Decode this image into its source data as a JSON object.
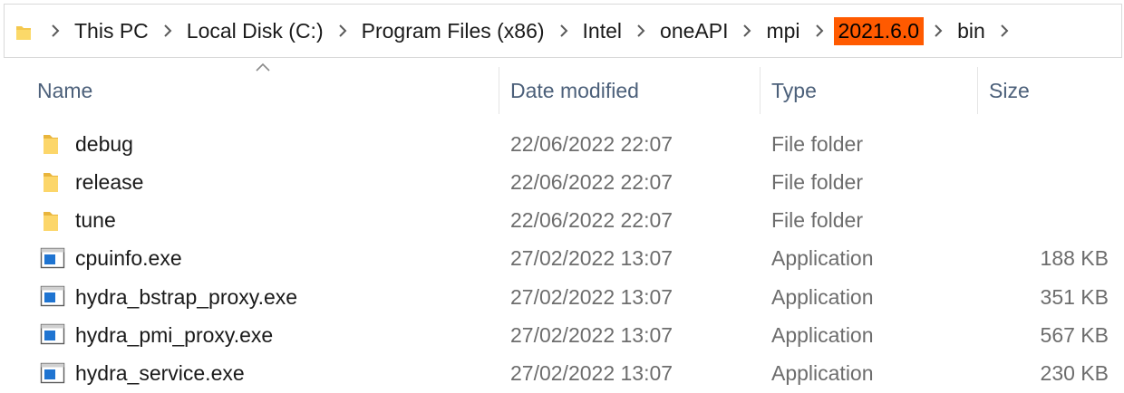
{
  "breadcrumb": [
    "This PC",
    "Local Disk (C:)",
    "Program Files (x86)",
    "Intel",
    "oneAPI",
    "mpi",
    "2021.6.0",
    "bin"
  ],
  "highlight_index": 6,
  "highlight_color": "#ff5a00",
  "columns": {
    "name": "Name",
    "date": "Date modified",
    "type": "Type",
    "size": "Size"
  },
  "sort": {
    "column": "name",
    "direction": "ascending"
  },
  "files": [
    {
      "name": "debug",
      "date": "22/06/2022 22:07",
      "type": "File folder",
      "size": "",
      "icon": "folder-icon"
    },
    {
      "name": "release",
      "date": "22/06/2022 22:07",
      "type": "File folder",
      "size": "",
      "icon": "folder-icon"
    },
    {
      "name": "tune",
      "date": "22/06/2022 22:07",
      "type": "File folder",
      "size": "",
      "icon": "folder-icon"
    },
    {
      "name": "cpuinfo.exe",
      "date": "27/02/2022 13:07",
      "type": "Application",
      "size": "188 KB",
      "icon": "application-icon"
    },
    {
      "name": "hydra_bstrap_proxy.exe",
      "date": "27/02/2022 13:07",
      "type": "Application",
      "size": "351 KB",
      "icon": "application-icon"
    },
    {
      "name": "hydra_pmi_proxy.exe",
      "date": "27/02/2022 13:07",
      "type": "Application",
      "size": "567 KB",
      "icon": "application-icon"
    },
    {
      "name": "hydra_service.exe",
      "date": "27/02/2022 13:07",
      "type": "Application",
      "size": "230 KB",
      "icon": "application-icon"
    }
  ]
}
